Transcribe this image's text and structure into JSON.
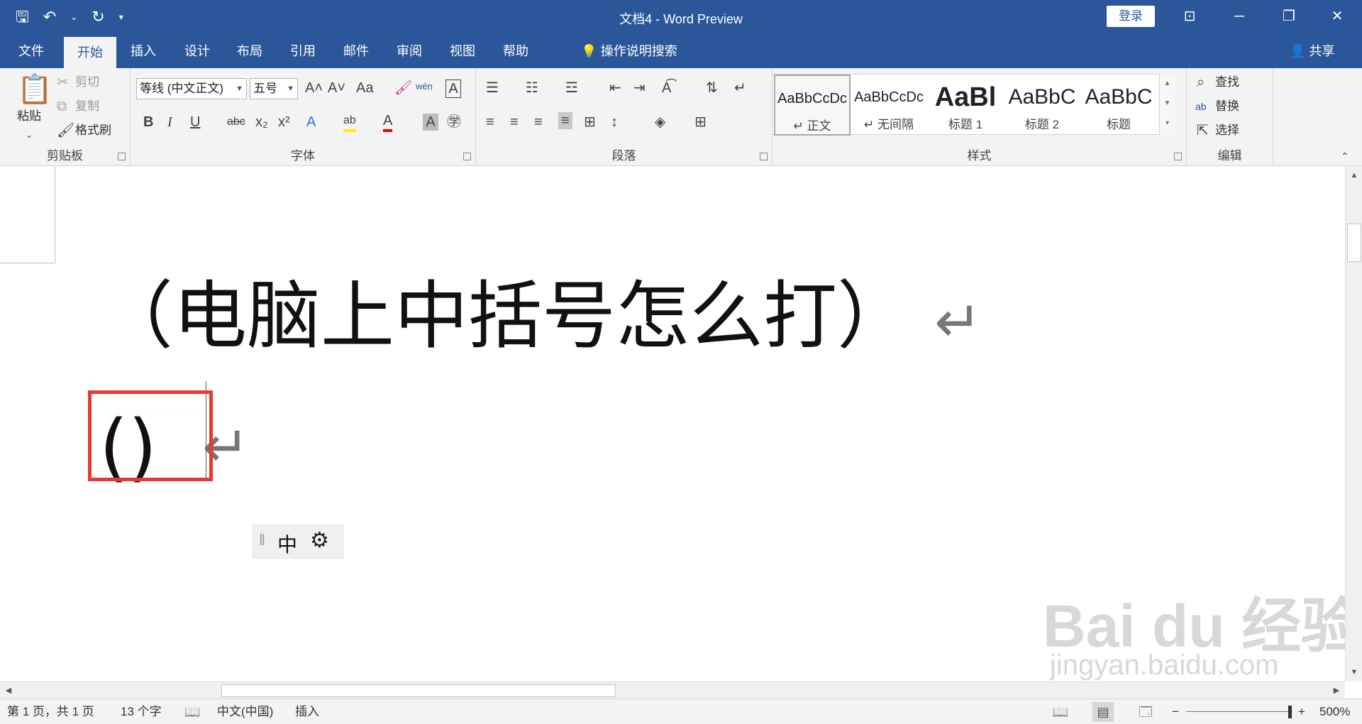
{
  "window": {
    "title": "文档4  -  Word Preview",
    "login_label": "登录",
    "controls": {
      "ribbon_display": "⊡",
      "minimize": "─",
      "restore": "❐",
      "close": "✕"
    }
  },
  "qat": {
    "save": "🖫",
    "undo": "↶",
    "undo_more": "⌄",
    "redo": "↻",
    "customize": "▾"
  },
  "tabs": [
    "文件",
    "开始",
    "插入",
    "设计",
    "布局",
    "引用",
    "邮件",
    "审阅",
    "视图",
    "帮助"
  ],
  "active_tab": "开始",
  "tell_me": "操作说明搜索",
  "share_label": "共享",
  "ribbon": {
    "clipboard": {
      "group_label": "剪贴板",
      "paste": "粘贴",
      "cut": "剪切",
      "copy": "复制",
      "format_painter": "格式刷"
    },
    "font": {
      "group_label": "字体",
      "font_name": "等线 (中文正文)",
      "font_size": "五号",
      "grow": "A˄",
      "shrink": "A˅",
      "change_case": "Aa",
      "clear": "🖌",
      "phonetic": "wén",
      "border_char": "A",
      "bold": "B",
      "italic": "I",
      "underline": "U",
      "strike": "abc",
      "sub": "x₂",
      "sup": "x²",
      "effects": "A",
      "highlight": "ab",
      "font_color": "A",
      "shading": "A",
      "enclose": "㊫"
    },
    "paragraph": {
      "group_label": "段落"
    },
    "styles": {
      "group_label": "样式",
      "items": [
        {
          "preview": "AaBbCcDc",
          "name": "↵ 正文"
        },
        {
          "preview": "AaBbCcDc",
          "name": "↵ 无间隔"
        },
        {
          "preview": "AaBl",
          "name": "标题 1"
        },
        {
          "preview": "AaBbC",
          "name": "标题 2"
        },
        {
          "preview": "AaBbC",
          "name": "标题"
        }
      ]
    },
    "editing": {
      "group_label": "编辑",
      "find": "查找",
      "replace": "替换",
      "select": "选择"
    }
  },
  "document": {
    "line1": "（电脑上中括号怎么打）",
    "line2": "()",
    "para_mark": "↵"
  },
  "ime": {
    "mode": "中",
    "settings": "⚙",
    "grip": "‖"
  },
  "watermark": {
    "main": "Bai du 经验",
    "sub": "jingyan.baidu.com"
  },
  "status": {
    "page": "第 1 页，共 1 页",
    "words": "13 个字",
    "language": "中文(中国)",
    "mode": "插入",
    "zoom": "500%",
    "zoom_minus": "−",
    "zoom_plus": "+"
  }
}
